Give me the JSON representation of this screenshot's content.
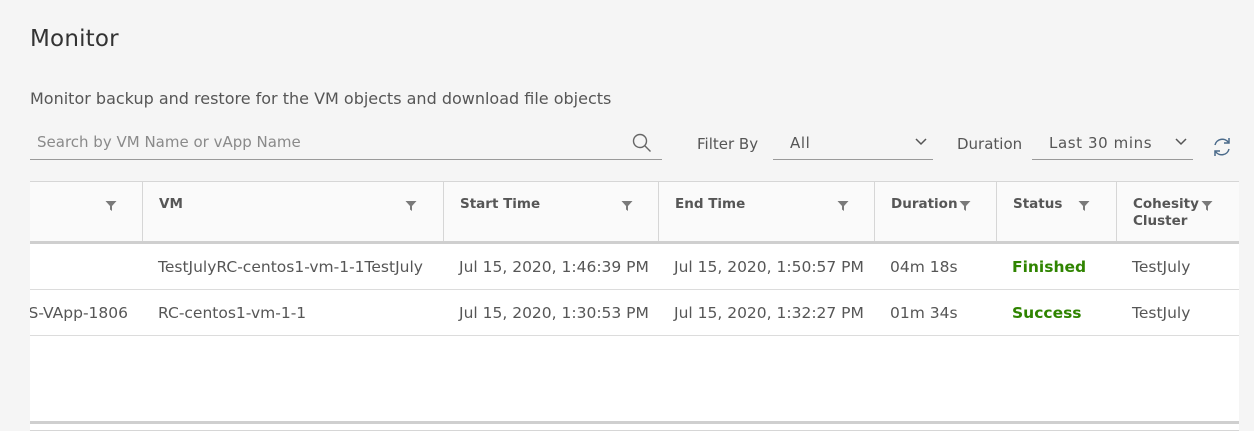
{
  "page": {
    "title": "Monitor",
    "subtitle": "Monitor backup and restore for the VM objects and download file objects"
  },
  "search": {
    "placeholder": "Search by VM Name or vApp Name",
    "value": ""
  },
  "filter": {
    "label": "Filter By",
    "selected": "All"
  },
  "duration": {
    "label": "Duration",
    "selected": "Last 30 mins"
  },
  "table": {
    "columns": [
      {
        "key": "vapp",
        "label": ""
      },
      {
        "key": "vm",
        "label": "VM"
      },
      {
        "key": "start",
        "label": "Start Time"
      },
      {
        "key": "end",
        "label": "End Time"
      },
      {
        "key": "duration",
        "label": "Duration"
      },
      {
        "key": "status",
        "label": "Status"
      },
      {
        "key": "cluster",
        "label": "Cohesity Cluster"
      }
    ],
    "rows": [
      {
        "vapp": "",
        "vm": "TestJulyRC-centos1-vm-1-1TestJuly",
        "start": "Jul 15, 2020, 1:46:39 PM",
        "end": "Jul 15, 2020, 1:50:57 PM",
        "duration": "04m 18s",
        "status": "Finished",
        "cluster": "TestJuly"
      },
      {
        "vapp": "S-VApp-1806",
        "vm": "RC-centos1-vm-1-1",
        "start": "Jul 15, 2020, 1:30:53 PM",
        "end": "Jul 15, 2020, 1:32:27 PM",
        "duration": "01m 34s",
        "status": "Success",
        "cluster": "TestJuly"
      }
    ]
  },
  "colors": {
    "status_success": "#2f8400"
  },
  "icons": {
    "search": "search-icon",
    "filter": "filter-icon",
    "chevron": "chevron-down-icon",
    "refresh": "refresh-icon"
  }
}
